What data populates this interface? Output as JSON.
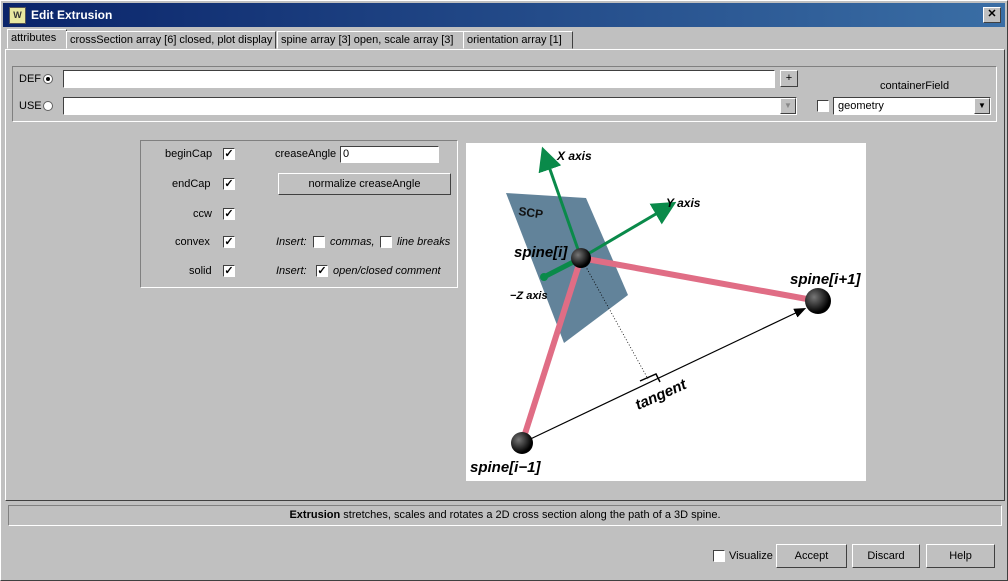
{
  "window": {
    "title": "Edit Extrusion",
    "close_glyph": "✕",
    "app_icon_text": "W"
  },
  "tabs": [
    {
      "label": "attributes"
    },
    {
      "label": "crossSection array [6] closed, plot display"
    },
    {
      "label": "spine array [3] open, scale array [3]"
    },
    {
      "label": "orientation array [1]"
    }
  ],
  "def_use": {
    "def_label": "DEF",
    "use_label": "USE",
    "def_value": "",
    "use_value": "",
    "plus_label": "+",
    "container_field_label": "containerField",
    "container_field_value": "geometry"
  },
  "attributes": {
    "begin_cap": {
      "label": "beginCap",
      "checked": "✓"
    },
    "end_cap": {
      "label": "endCap",
      "checked": "✓"
    },
    "ccw": {
      "label": "ccw",
      "checked": "✓"
    },
    "convex": {
      "label": "convex",
      "checked": "✓"
    },
    "solid": {
      "label": "solid",
      "checked": "✓"
    },
    "crease_angle_label": "creaseAngle",
    "crease_angle_value": "0",
    "normalize_button": "normalize creaseAngle",
    "insert_label_1": "Insert:",
    "commas_label": "commas,",
    "line_breaks_label": "line breaks",
    "insert_label_2": "Insert:",
    "open_closed_label": "open/closed comment",
    "open_closed_checked": "✓"
  },
  "diagram": {
    "x_axis": "X axis",
    "y_axis": "Y axis",
    "z_axis": "−Z axis",
    "scp": "SCP",
    "spine_i": "spine[i]",
    "spine_i_plus": "spine[i+1]",
    "spine_i_minus": "spine[i−1]",
    "tangent": "tangent",
    "colors": {
      "spine_rod": "#e06d85",
      "axis": "#0a8a4a",
      "plane": "#2e5a78"
    }
  },
  "status": {
    "bold": "Extrusion",
    "text": " stretches, scales and rotates a 2D cross section along the path of a 3D spine."
  },
  "footer": {
    "visualize_label": "Visualize",
    "accept": "Accept",
    "discard": "Discard",
    "help": "Help"
  }
}
